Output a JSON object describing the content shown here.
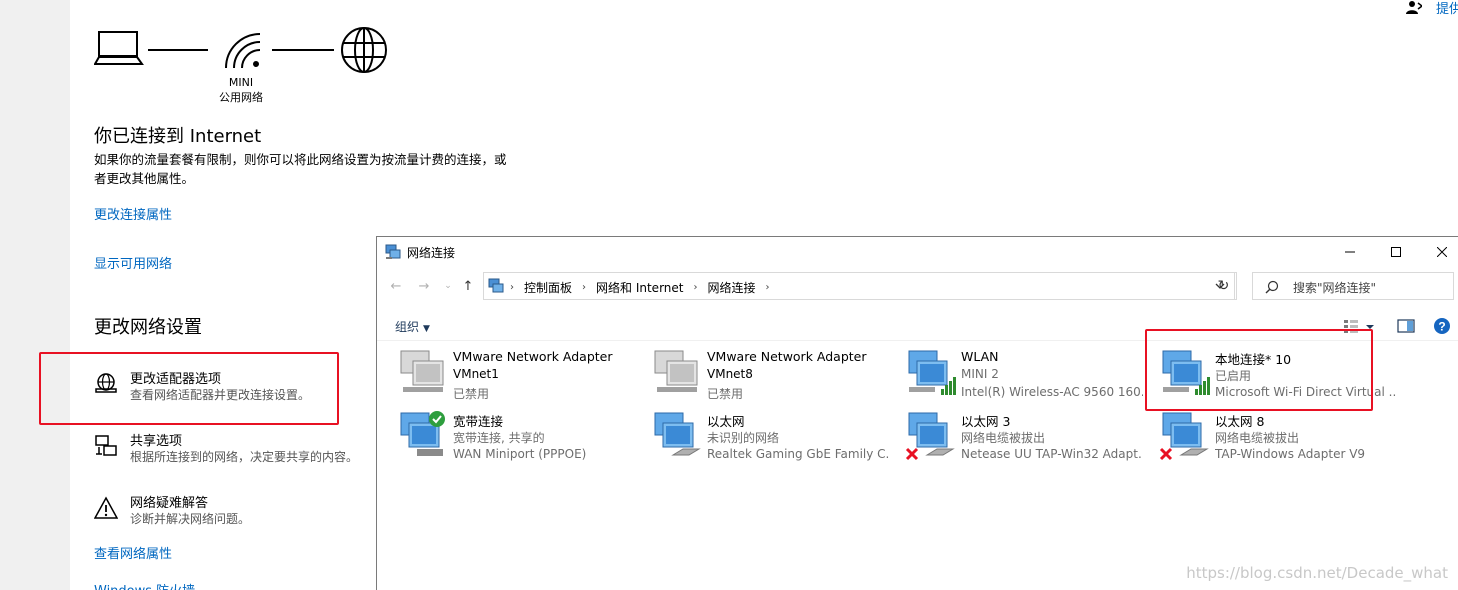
{
  "settings": {
    "corner_label": "提供",
    "topology": {
      "network_name": "MINI",
      "network_type": "公用网络"
    },
    "status_title": "你已连接到 Internet",
    "status_desc": "如果你的流量套餐有限制，则你可以将此网络设置为按流量计费的连接，或者更改其他属性。",
    "link_change_props": "更改连接属性",
    "link_show_networks": "显示可用网络",
    "section_title": "更改网络设置",
    "options": [
      {
        "title": "更改适配器选项",
        "subtitle": "查看网络适配器并更改连接设置。"
      },
      {
        "title": "共享选项",
        "subtitle": "根据所连接到的网络，决定要共享的内容。"
      },
      {
        "title": "网络疑难解答",
        "subtitle": "诊断并解决网络问题。"
      }
    ],
    "link_view_props": "查看网络属性",
    "link_firewall": "Windows 防火墙"
  },
  "window": {
    "title": "网络连接",
    "breadcrumb": [
      "控制面板",
      "网络和 Internet",
      "网络连接"
    ],
    "search_placeholder": "搜索\"网络连接\"",
    "organize_label": "组织",
    "connections": [
      {
        "name": "VMware Network Adapter",
        "status": "VMnet1",
        "device": "已禁用"
      },
      {
        "name": "VMware Network Adapter",
        "status": "VMnet8",
        "device": "已禁用"
      },
      {
        "name": "WLAN",
        "status": "MINI 2",
        "device": "Intel(R) Wireless-AC 9560 160..."
      },
      {
        "name": "本地连接* 10",
        "status": "已启用",
        "device": "Microsoft Wi-Fi Direct Virtual ..."
      },
      {
        "name": "宽带连接",
        "status": "宽带连接, 共享的",
        "device": "WAN Miniport (PPPOE)"
      },
      {
        "name": "以太网",
        "status": "未识别的网络",
        "device": "Realtek Gaming GbE Family C..."
      },
      {
        "name": "以太网 3",
        "status": "网络电缆被拔出",
        "device": "Netease UU TAP-Win32 Adapt..."
      },
      {
        "name": "以太网 8",
        "status": "网络电缆被拔出",
        "device": "TAP-Windows Adapter V9"
      }
    ]
  },
  "watermark": "https://blog.csdn.net/Decade_what",
  "colors": {
    "link": "#0067c0",
    "highlight": "#e81123",
    "signal": "#2e8b2e"
  }
}
